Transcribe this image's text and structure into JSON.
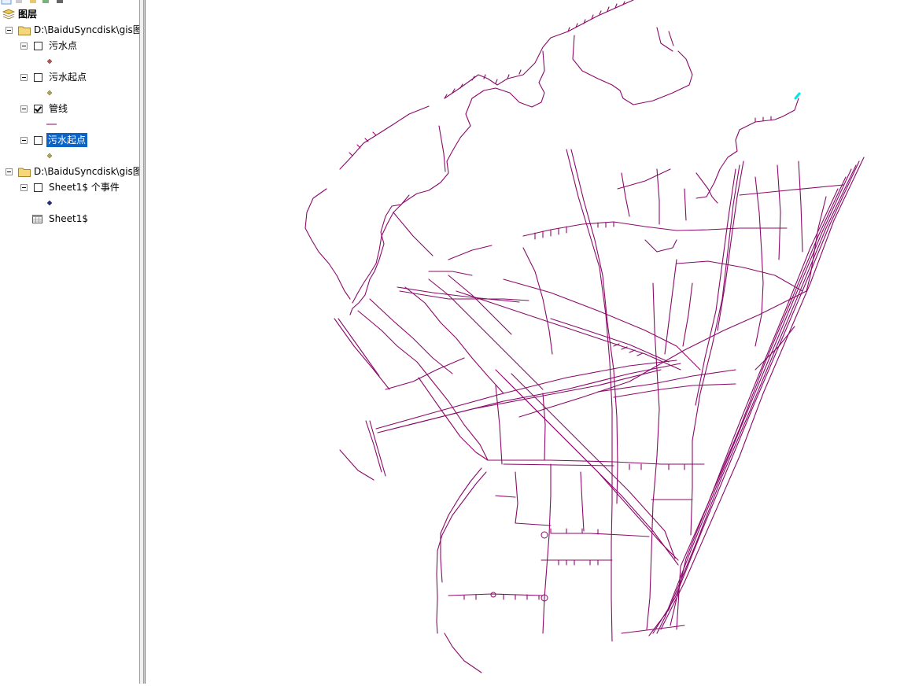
{
  "toc": {
    "root_label": "图层",
    "items": [
      {
        "label": "D:\\BaiduSyncdisk\\gis图"
      },
      {
        "label": "污水点",
        "symbol_color": "#c0504d"
      },
      {
        "label": "污水起点",
        "symbol_color": "#b5a642"
      },
      {
        "label": "管线",
        "symbol_color": "#a0307a"
      },
      {
        "label": "污水起点",
        "symbol_color": "#b5a642"
      },
      {
        "label": "D:\\BaiduSyncdisk\\gis图"
      },
      {
        "label": "Sheet1$ 个事件",
        "symbol_color": "#1f2a8a"
      },
      {
        "label": "Sheet1$"
      }
    ]
  },
  "map": {
    "pipe_color": "#8b0a6a",
    "highlight_color": "#00e5e5"
  }
}
